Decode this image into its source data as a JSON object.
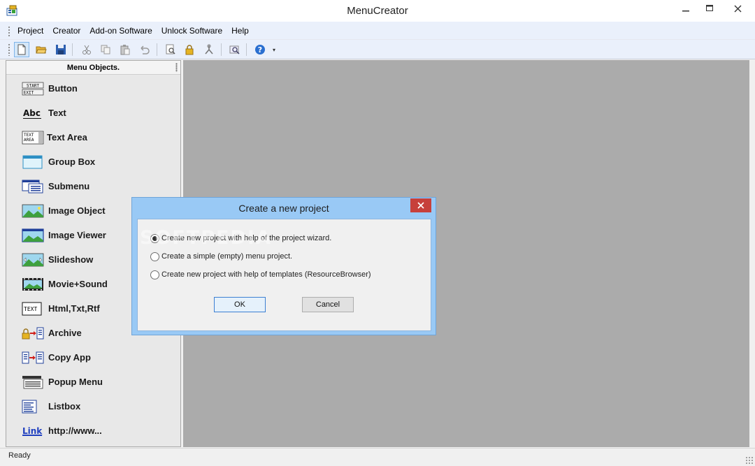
{
  "window": {
    "title": "MenuCreator",
    "min_icon": "minimize-icon",
    "max_icon": "maximize-icon",
    "close_icon": "close-icon",
    "app_icon": "menucreator-app-icon"
  },
  "menu": [
    {
      "label": "Project"
    },
    {
      "label": "Creator"
    },
    {
      "label": "Add-on Software"
    },
    {
      "label": "Unlock Software"
    },
    {
      "label": "Help"
    }
  ],
  "toolbar": {
    "buttons": [
      {
        "icon": "new-document-icon"
      },
      {
        "icon": "open-folder-icon"
      },
      {
        "icon": "save-icon"
      },
      {
        "icon": "cut-icon"
      },
      {
        "icon": "copy-icon"
      },
      {
        "icon": "paste-icon"
      },
      {
        "icon": "undo-icon"
      },
      {
        "icon": "preview-icon"
      },
      {
        "icon": "lock-icon"
      },
      {
        "icon": "tools-icon"
      },
      {
        "icon": "find-icon"
      },
      {
        "icon": "help-icon"
      }
    ]
  },
  "panel": {
    "header": "Menu Objects.",
    "items": [
      {
        "label": "Button",
        "icon": "button-object-icon",
        "icon_text": "START EXIT"
      },
      {
        "label": "Text",
        "icon": "text-object-icon",
        "icon_text": "Abc"
      },
      {
        "label": "Text Area",
        "icon": "text-area-object-icon",
        "icon_text": "TEXT AREA"
      },
      {
        "label": "Group Box",
        "icon": "group-box-object-icon"
      },
      {
        "label": "Submenu",
        "icon": "submenu-object-icon"
      },
      {
        "label": "Image Object",
        "icon": "image-object-icon"
      },
      {
        "label": "Image Viewer",
        "icon": "image-viewer-object-icon"
      },
      {
        "label": "Slideshow",
        "icon": "slideshow-object-icon"
      },
      {
        "label": "Movie+Sound",
        "icon": "movie-sound-object-icon"
      },
      {
        "label": "Html,Txt,Rtf",
        "icon": "html-text-object-icon",
        "icon_text": "TEXT"
      },
      {
        "label": "Archive",
        "icon": "archive-object-icon"
      },
      {
        "label": "Copy App",
        "icon": "copy-app-object-icon"
      },
      {
        "label": "Popup Menu",
        "icon": "popup-menu-object-icon"
      },
      {
        "label": "Listbox",
        "icon": "listbox-object-icon"
      },
      {
        "label": "http://www...",
        "icon": "link-object-icon",
        "icon_text": "Link"
      }
    ]
  },
  "dialog": {
    "title": "Create a new project",
    "close_icon": "close-icon",
    "options": [
      {
        "label": "Create new project with help of the project wizard.",
        "checked": true
      },
      {
        "label": "Create a simple (empty) menu project.",
        "checked": false
      },
      {
        "label": "Create new project with help of templates (ResourceBrowser)",
        "checked": false
      }
    ],
    "ok_label": "OK",
    "cancel_label": "Cancel"
  },
  "watermark": "SOFTPEDIA",
  "status": {
    "text": "Ready"
  },
  "colors": {
    "dialog_frame": "#99c9f5",
    "close_red": "#c7403b",
    "workspace": "#ababab",
    "menubar": "#eaf0fb"
  }
}
